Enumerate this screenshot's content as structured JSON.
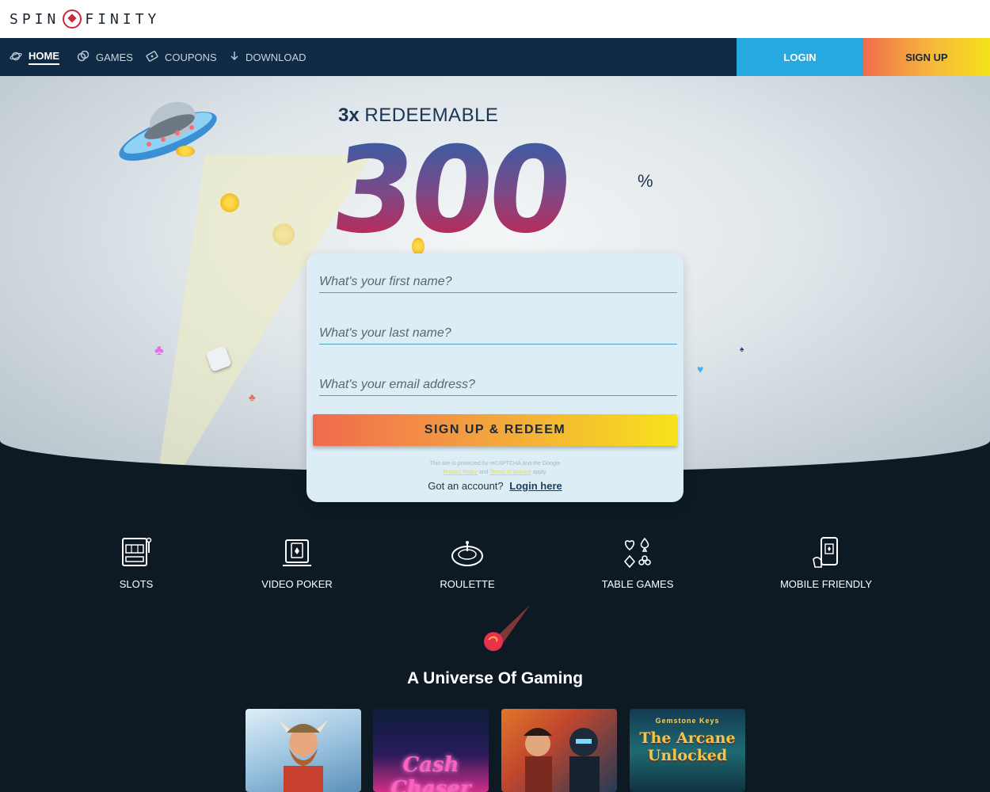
{
  "brand": {
    "name_left": "SPIN",
    "name_right": "FINITY",
    "accent": "#c92a3d"
  },
  "nav": {
    "items": [
      {
        "label": "HOME",
        "icon": "planet-icon",
        "active": true
      },
      {
        "label": "GAMES",
        "icon": "chips-icon",
        "active": false
      },
      {
        "label": "COUPONS",
        "icon": "coupon-icon",
        "active": false
      },
      {
        "label": "DOWNLOAD",
        "icon": "download-arrow-icon",
        "active": false
      }
    ],
    "login_label": "LOGIN",
    "signup_label": "SIGN UP",
    "login_color": "#25a9e0",
    "bg_color": "#0e2a44"
  },
  "hero": {
    "multiplier": "3x",
    "redeemable": "REDEEMABLE",
    "amount": "300",
    "percent": "%"
  },
  "form": {
    "first_name_placeholder": "What's your first name?",
    "last_name_placeholder": "What's your last name?",
    "email_placeholder": "What's your email address?",
    "submit_label": "SIGN UP & REDEEM",
    "legal_text": "This site is protected by reCAPTCHA and the Google",
    "privacy_label": "Privacy Policy",
    "legal_and": "and",
    "terms_label": "Terms of Service",
    "legal_apply": "apply.",
    "account_prompt": "Got an account?",
    "login_link": "Login here"
  },
  "features": [
    {
      "label": "SLOTS",
      "icon": "slot-machine-icon"
    },
    {
      "label": "VIDEO POKER",
      "icon": "video-poker-icon"
    },
    {
      "label": "ROULETTE",
      "icon": "roulette-icon"
    },
    {
      "label": "TABLE GAMES",
      "icon": "card-suits-icon"
    },
    {
      "label": "MOBILE FRIENDLY",
      "icon": "mobile-phone-icon"
    }
  ],
  "section": {
    "title": "A Universe Of Gaming"
  },
  "games": [
    {
      "title": "viking-game",
      "text": ""
    },
    {
      "title": "cash-chaser",
      "text": "Cash Chaser"
    },
    {
      "title": "samurai-ninja",
      "text": ""
    },
    {
      "title": "the-arcane-unlocked",
      "text": "The Arcane Unlocked",
      "subtitle": "Gemstone Keys"
    }
  ]
}
